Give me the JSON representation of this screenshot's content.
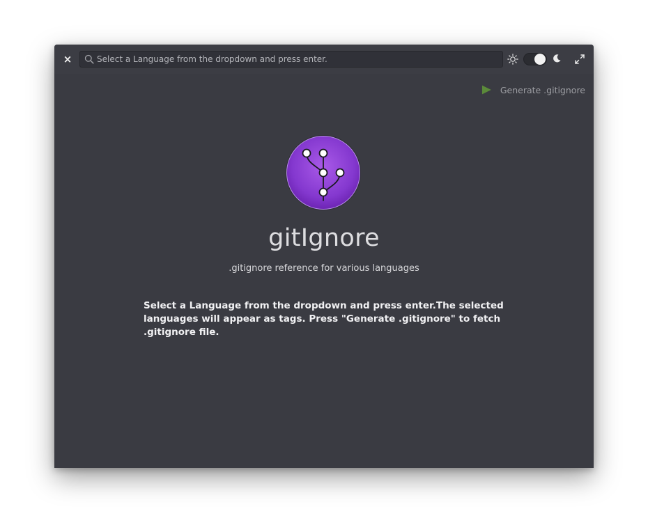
{
  "window": {
    "close_label": "×"
  },
  "search": {
    "placeholder": "Select a Language from the dropdown and press enter.",
    "value": ""
  },
  "theme_toggle": {
    "state": "dark"
  },
  "toolbar": {
    "generate_label": "Generate .gitignore"
  },
  "app": {
    "title": "gitIgnore",
    "subtitle": ".gitignore reference for various languages",
    "instructions": "Select a Language from the dropdown and press enter.The selected languages will appear as tags. Press \"Generate .gitignore\" to fetch .gitignore file."
  },
  "icons": {
    "close": "close-icon",
    "search": "search-icon",
    "sun": "sun-icon",
    "moon": "moon-icon",
    "maximize": "maximize-icon",
    "play": "play-icon",
    "logo": "git-branch-logo-icon"
  },
  "colors": {
    "window_bg": "#3a3b42",
    "logo_purple": "#8a3fd0",
    "play_green": "#5b8a3a"
  }
}
